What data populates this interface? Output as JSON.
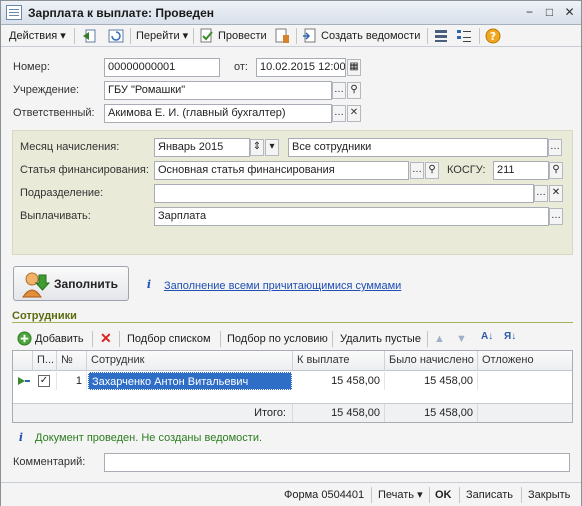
{
  "window": {
    "title": "Зарплата к выплате: Проведен",
    "buttons": [
      "−",
      "□",
      "✕"
    ]
  },
  "toolbar": {
    "actions": "Действия",
    "goto": "Перейти",
    "post": "Провести",
    "create_statements": "Создать ведомости"
  },
  "header": {
    "number_label": "Номер:",
    "number_value": "00000000001",
    "date_label": "от:",
    "date_value": "10.02.2015 12:00:00",
    "org_label": "Учреждение:",
    "org_value": "ГБУ \"Ромашки\"",
    "resp_label": "Ответственный:",
    "resp_value": "Акимова Е. И. (главный бухгалтер)"
  },
  "params": {
    "month_label": "Месяц начисления:",
    "month_value": "Январь 2015",
    "employees_value": "Все сотрудники",
    "fin_label": "Статья финансирования:",
    "fin_value": "Основная статья финансирования",
    "kosgu_label": "КОСГУ:",
    "kosgu_value": "211",
    "dept_label": "Подразделение:",
    "dept_value": "",
    "pay_label": "Выплачивать:",
    "pay_value": "Зарплата"
  },
  "fill": {
    "button_label": "Заполнить",
    "link": "Заполнение всеми причитающимися суммами"
  },
  "employees_section": {
    "title": "Сотрудники",
    "toolbar": {
      "add": "Добавить",
      "select_list": "Подбор списком",
      "select_condition": "Подбор по условию",
      "delete_empty": "Удалить пустые"
    },
    "columns": [
      "П...",
      "№",
      "Сотрудник",
      "К выплате",
      "Было начислено",
      "Отложено"
    ],
    "rows": [
      {
        "checked": true,
        "n": "1",
        "employee": "Захарченко Антон Витальевич",
        "to_pay": "15 458,00",
        "accrued": "15 458,00",
        "deferred": ""
      }
    ],
    "footer": {
      "total_label": "Итого:",
      "to_pay": "15 458,00",
      "accrued": "15 458,00"
    }
  },
  "info": "Документ проведен. Не созданы ведомости.",
  "comment": {
    "label": "Комментарий:",
    "value": ""
  },
  "statusbar": {
    "form": "Форма 0504401",
    "print": "Печать",
    "ok": "OK",
    "save": "Записать",
    "close": "Закрыть"
  },
  "colors": {
    "accent_link": "#1f4fb3",
    "panel_bg": "#e9ead8",
    "selection": "#2e6ec7",
    "info_text": "#2b7d1f"
  }
}
